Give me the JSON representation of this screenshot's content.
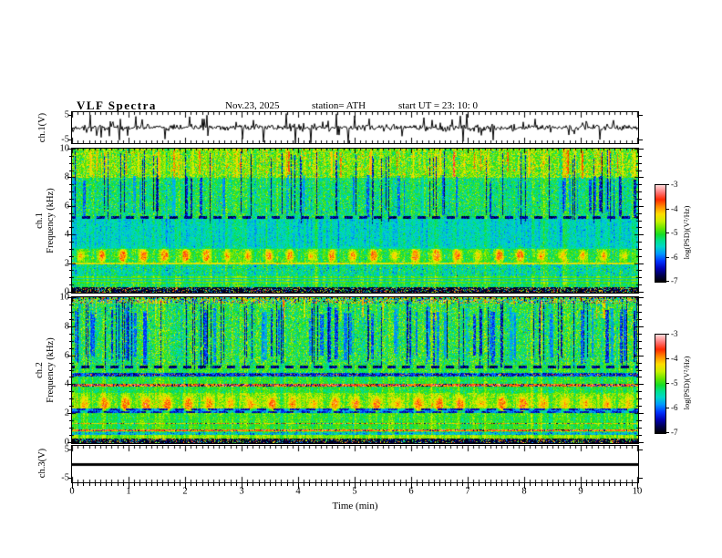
{
  "title": {
    "main": "VLF  Spectra",
    "date": "Nov.23, 2025",
    "station": "station= ATH",
    "start_ut": "start UT  =   23: 10: 0"
  },
  "axes": {
    "time_label": "Time  (min)",
    "time_ticks": [
      "0",
      "1",
      "2",
      "3",
      "4",
      "5",
      "6",
      "7",
      "8",
      "9",
      "10"
    ],
    "ch1_wave_label": "ch.1(V)",
    "wave_yticks": [
      "5",
      "-5"
    ],
    "ch1_spec_label1": "ch.1",
    "ch1_spec_label2": "Frequency  (kHz)",
    "ch2_spec_label1": "ch.2",
    "ch2_spec_label2": "Frequency  (kHz)",
    "freq_yticks": [
      "10",
      "8",
      "6",
      "4",
      "2",
      "0"
    ],
    "ch3_label": "ch.3(V)",
    "ch3_yticks": [
      "5",
      "-5"
    ]
  },
  "colorbar": {
    "label": "log(PSD)(V²/Hz)",
    "ticks": [
      "-3",
      "-4",
      "-5",
      "-6",
      "-7"
    ],
    "zlim": [
      -7,
      -3
    ],
    "stops": [
      [
        -7.0,
        "#000000"
      ],
      [
        -6.75,
        "#00004a"
      ],
      [
        -6.45,
        "#0000b4"
      ],
      [
        -6.15,
        "#0032ff"
      ],
      [
        -5.85,
        "#0096ff"
      ],
      [
        -5.55,
        "#00d7c8"
      ],
      [
        -5.3,
        "#00e08c"
      ],
      [
        -5.05,
        "#14dc28"
      ],
      [
        -4.8,
        "#64e600"
      ],
      [
        -4.5,
        "#c8f000"
      ],
      [
        -4.2,
        "#ffdc00"
      ],
      [
        -3.9,
        "#ff8c00"
      ],
      [
        -3.6,
        "#ff2800"
      ],
      [
        -3.3,
        "#ff7878"
      ],
      [
        -3.0,
        "#ffdcdc"
      ]
    ]
  },
  "chart_data": [
    {
      "type": "line",
      "name": "ch1-voltage-waveform",
      "ylabel": "ch.1(V)",
      "ylim": [
        -5,
        5
      ],
      "yticks": [
        "5",
        "-5"
      ],
      "xlim": [
        0,
        10
      ],
      "description": "broadband noise of ~0.5 V rms centred on 0 V with frequent impulsive sferic spikes reaching +/-5 V",
      "mean_v": 0,
      "noise_sigma_v": 0.5,
      "spike_prob": 0.1,
      "spike_amp_v": [
        1.2,
        4.8
      ]
    },
    {
      "type": "heatmap",
      "name": "ch1-spectrogram",
      "ylabel_line1": "ch.1",
      "ylabel_line2": "Frequency  (kHz)",
      "yticks": [
        "10",
        "8",
        "6",
        "4",
        "2",
        "0"
      ],
      "xlim_min": [
        0,
        10
      ],
      "flim_khz": [
        0,
        10
      ],
      "zlabel": "log(PSD)(V²/Hz)",
      "zlim": [
        -7,
        -3
      ],
      "column_mod": 0.18,
      "bands": [
        [
          0.0,
          0.35,
          -6.9,
          0.2
        ],
        [
          0.35,
          0.6,
          -5.15,
          0.25
        ],
        [
          0.6,
          1.1,
          -4.9,
          0.12
        ],
        [
          1.1,
          1.95,
          -5.35,
          0.28
        ],
        [
          1.95,
          3.05,
          -5.05,
          0.25
        ],
        [
          3.05,
          5.1,
          -5.5,
          0.18
        ],
        [
          5.1,
          8.0,
          -5.2,
          0.3
        ],
        [
          8.0,
          10.01,
          -4.75,
          0.35
        ]
      ],
      "hlines": [
        {
          "f": 0.75,
          "hw": 0.03,
          "level": -5.6,
          "var": 0.1
        },
        {
          "f": 0.95,
          "hw": 0.03,
          "level": -5.6,
          "var": 0.1
        },
        {
          "f": 2.0,
          "hw": 0.05,
          "level": -4.35,
          "var": 0.2
        },
        {
          "f": 3.05,
          "hw": 0.03,
          "level": -5.35,
          "var": 0.1
        },
        {
          "f": 5.22,
          "hw": 0.07,
          "level": -6.6,
          "var": 0.25,
          "dashed": 1,
          "don": 9,
          "doff": 7
        }
      ],
      "speckle_band": [
        0.0,
        0.35,
        0.3
      ],
      "blobs": {
        "f_center": 2.55,
        "f_sigma": 0.3,
        "t_start": 0.15,
        "t_period": 0.37,
        "t_sigma": 0.045,
        "level": -3.9
      },
      "streaks": [
        {
          "count": 40,
          "f0": 5.25,
          "f1": 8.2,
          "level": -6.25,
          "level_var": 0.35,
          "wmin": 1,
          "wmax": 3
        },
        {
          "count": 55,
          "f0": 8.0,
          "f1": 10.0,
          "level": -4.0,
          "level_var": 0.45,
          "wmin": 1,
          "wmax": 2
        },
        {
          "count": 12,
          "f0": 8.3,
          "f1": 10.0,
          "level": -3.5,
          "level_var": 0.2,
          "wmin": 1,
          "wmax": 2
        },
        {
          "count": 45,
          "f0": 4.95,
          "f1": 10.0,
          "level": -7.0,
          "level_var": 0.05,
          "wmin": 1,
          "wmax": 1
        }
      ]
    },
    {
      "type": "heatmap",
      "name": "ch2-spectrogram",
      "ylabel_line1": "ch.2",
      "ylabel_line2": "Frequency  (kHz)",
      "yticks": [
        "10",
        "8",
        "6",
        "4",
        "2",
        "0"
      ],
      "xlim_min": [
        0,
        10
      ],
      "flim_khz": [
        0,
        10
      ],
      "zlabel": "log(PSD)(V²/Hz)",
      "zlim": [
        -7,
        -3
      ],
      "column_mod": 0.2,
      "bands": [
        [
          0.0,
          0.3,
          -6.9,
          0.2
        ],
        [
          0.3,
          0.55,
          -4.7,
          0.15
        ],
        [
          0.55,
          0.75,
          -5.6,
          0.3
        ],
        [
          0.75,
          1.4,
          -5.0,
          0.18
        ],
        [
          1.4,
          2.05,
          -5.0,
          0.2
        ],
        [
          2.05,
          2.35,
          -5.9,
          0.25
        ],
        [
          2.35,
          3.45,
          -4.75,
          0.25
        ],
        [
          3.45,
          4.55,
          -5.05,
          0.2
        ],
        [
          4.55,
          4.82,
          -6.1,
          0.3
        ],
        [
          4.82,
          5.4,
          -5.05,
          0.25
        ],
        [
          5.4,
          9.6,
          -5.1,
          0.35
        ],
        [
          9.6,
          10.01,
          -5.0,
          0.85
        ]
      ],
      "hlines": [
        {
          "f": 0.85,
          "hw": 0.07,
          "level": -3.8,
          "var": 0.3,
          "dark_prob": 0.15
        },
        {
          "f": 1.32,
          "hw": 0.05,
          "level": -4.2,
          "var": 0.35,
          "dark_prob": 0.2
        },
        {
          "f": 2.1,
          "hw": 0.04,
          "level": -6.4,
          "var": 0.25,
          "dashed": 1,
          "don": 10,
          "doff": 8
        },
        {
          "f": 2.3,
          "hw": 0.04,
          "level": -6.4,
          "var": 0.25,
          "dashed": 1,
          "don": 10,
          "doff": 8
        },
        {
          "f": 3.97,
          "hw": 0.09,
          "level": -3.7,
          "var": 0.3,
          "dark_prob": 0.3
        },
        {
          "f": 4.68,
          "hw": 0.08,
          "level": -6.5,
          "var": 0.3,
          "dashed": 1,
          "don": 12,
          "doff": 6,
          "bright_prob": 0.22,
          "bright_level": -3.9
        },
        {
          "f": 5.22,
          "hw": 0.07,
          "level": -6.6,
          "var": 0.25,
          "dashed": 1,
          "don": 9,
          "doff": 7
        }
      ],
      "speckle_band": [
        0.0,
        0.3,
        0.3
      ],
      "blobs": {
        "f_center": 2.65,
        "f_sigma": 0.33,
        "t_start": 0.2,
        "t_period": 0.37,
        "t_sigma": 0.05,
        "level": -3.9
      },
      "streaks": [
        {
          "count": 48,
          "f0": 5.5,
          "f1": 9.4,
          "level": -6.35,
          "level_var": 0.3,
          "wmin": 2,
          "wmax": 4
        },
        {
          "count": 20,
          "f0": 8.4,
          "f1": 10.0,
          "level": -4.1,
          "level_var": 0.4,
          "wmin": 1,
          "wmax": 2
        },
        {
          "count": 60,
          "f0": 5.15,
          "f1": 10.0,
          "level": -7.0,
          "level_var": 0.05,
          "wmin": 1,
          "wmax": 1
        }
      ]
    },
    {
      "type": "line",
      "name": "ch3-flat-line",
      "ylabel": "ch.3(V)",
      "ylim": [
        -5,
        5
      ],
      "yticks": [
        "5",
        "-5"
      ],
      "xlim": [
        0,
        10
      ],
      "xlabel": "Time  (min)",
      "xticks": [
        "0",
        "1",
        "2",
        "3",
        "4",
        "5",
        "6",
        "7",
        "8",
        "9",
        "10"
      ],
      "description": "constant 0 V thick trace (channel inactive)",
      "value_v": 0
    }
  ]
}
